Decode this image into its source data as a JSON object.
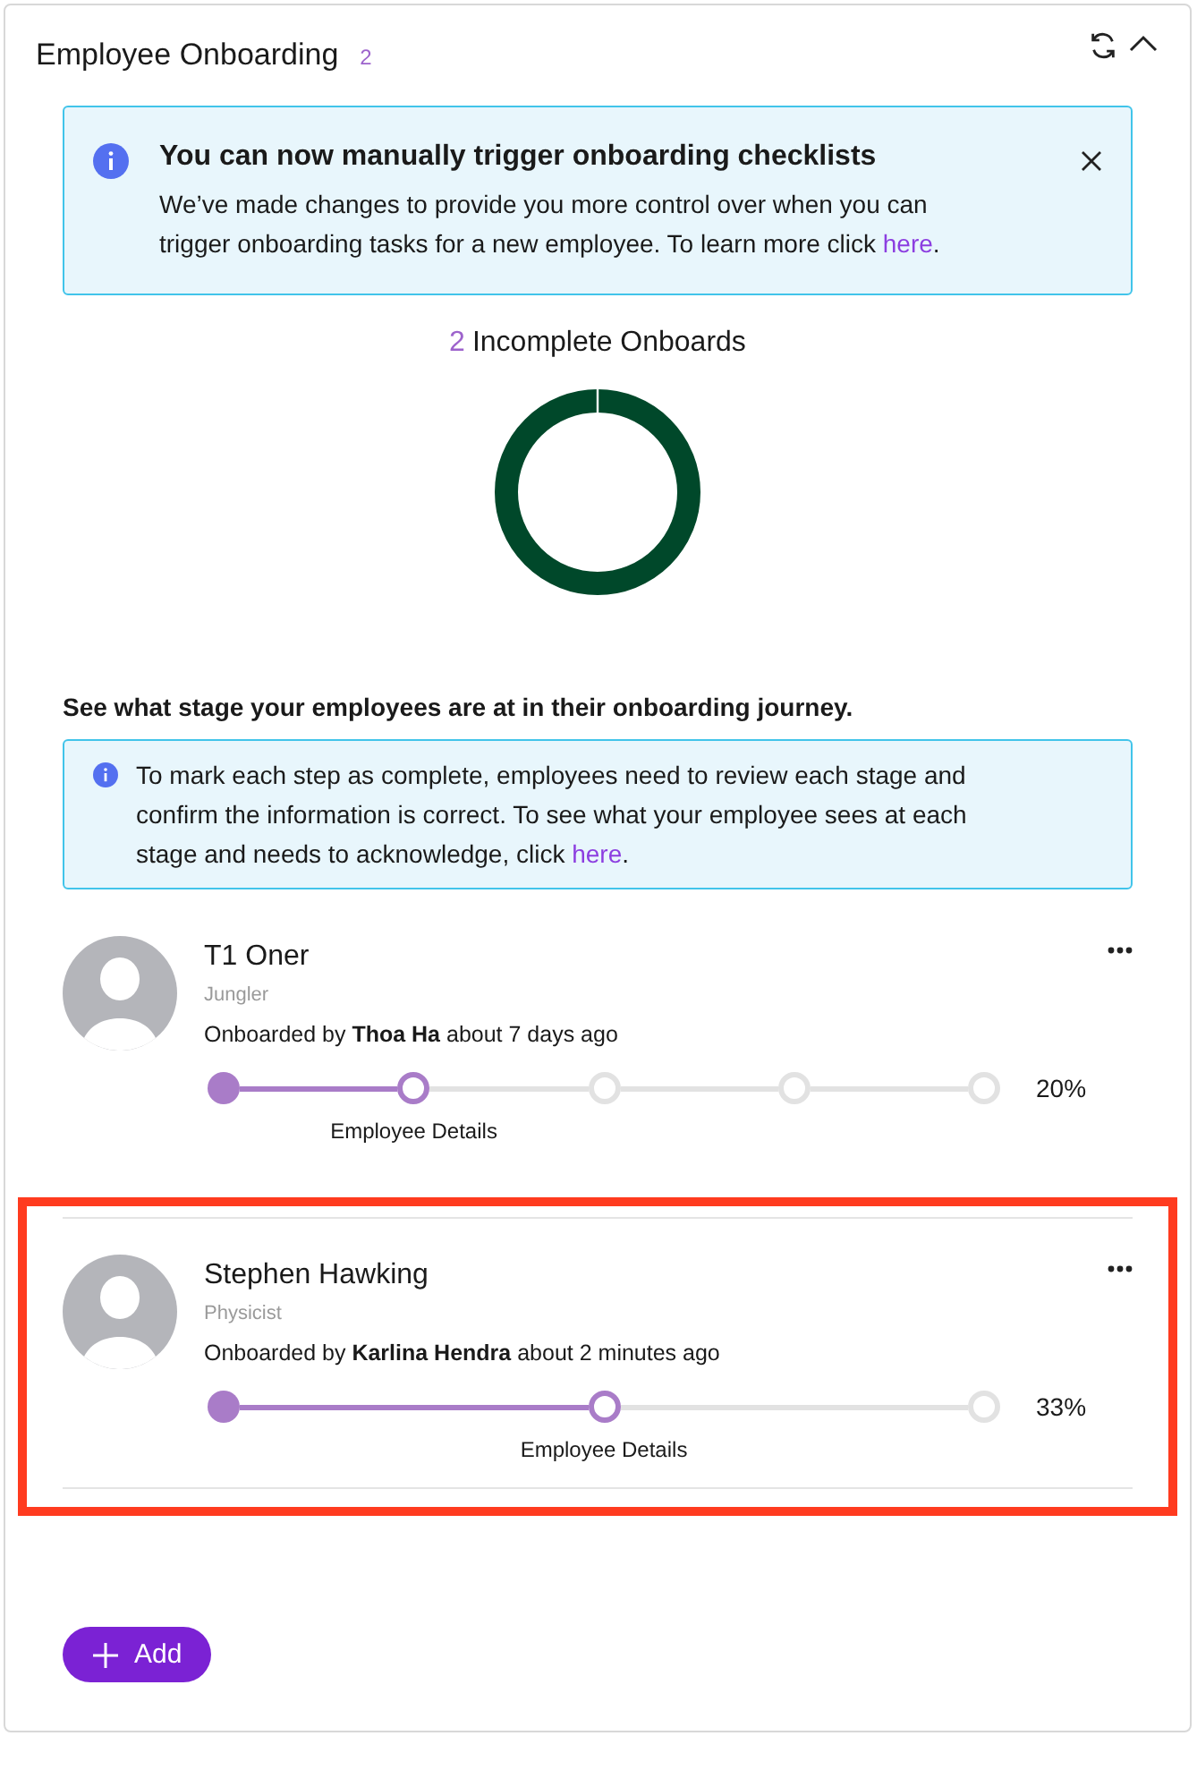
{
  "header": {
    "title": "Employee Onboarding",
    "count": "2"
  },
  "banner": {
    "title": "You can now manually trigger onboarding checklists",
    "text": "We’ve made changes to provide you more control over when you can trigger onboarding tasks for a new employee. To learn more click ",
    "link": "here",
    "after": "."
  },
  "summary": {
    "count": "2",
    "label": "Incomplete Onboards"
  },
  "stages_heading": "See what stage your employees are at in their onboarding journey.",
  "stages_note": {
    "text": "To mark each step as complete, employees need to review each stage and confirm the information is correct. To see what your employee sees at each stage and needs to acknowledge, click ",
    "link": "here",
    "after": "."
  },
  "employees": [
    {
      "name": "T1 Oner",
      "role": "Jungler",
      "onboarded": "Onboarded by **Thoa Ha** about 7 days ago",
      "highlighted": false,
      "steps": [
        {
          "completed": true,
          "current": false
        },
        {
          "completed": false,
          "current": true
        },
        {
          "completed": false,
          "current": false
        },
        {
          "completed": false,
          "current": false
        },
        {
          "completed": false,
          "current": false
        }
      ],
      "step_label": "Employee Details",
      "percent": "20%"
    },
    {
      "name": "Stephen Hawking",
      "role": "Physicist",
      "onboarded": "Onboarded by **Karlina Hendra** about 2 minutes ago",
      "highlighted": true,
      "steps": [
        {
          "completed": true,
          "current": false
        },
        {
          "completed": false,
          "current": true
        },
        {
          "completed": false,
          "current": false
        }
      ],
      "step_label": "Employee Details",
      "percent": "33%"
    }
  ],
  "add_button": "Add"
}
